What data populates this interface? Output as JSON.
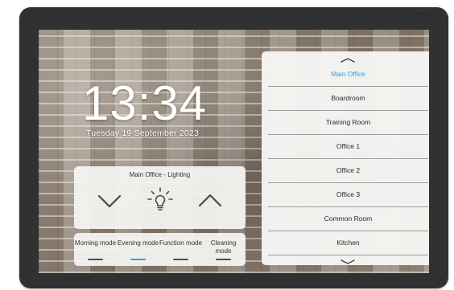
{
  "clock": {
    "time": "13:34",
    "date": "Tuesday 19 September 2023"
  },
  "lighting": {
    "title": "Main Office - Lighting",
    "controls": [
      {
        "name": "decrease-lighting-button",
        "icon": "chevron-down-icon"
      },
      {
        "name": "lighting-toggle-button",
        "icon": "lightbulb-icon"
      },
      {
        "name": "increase-lighting-button",
        "icon": "chevron-up-icon"
      }
    ]
  },
  "modes": [
    {
      "label": "Morning mode",
      "active": false
    },
    {
      "label": "Evening mode",
      "active": true
    },
    {
      "label": "Function mode",
      "active": false
    },
    {
      "label": "Cleaning mode",
      "active": false
    }
  ],
  "rooms": {
    "scroll_up_icon": "chevron-up-icon",
    "scroll_down_icon": "chevron-down-icon",
    "items": [
      {
        "label": "Main Office",
        "active": true
      },
      {
        "label": "Boardroom",
        "active": false
      },
      {
        "label": "Training Room",
        "active": false
      },
      {
        "label": "Office 1",
        "active": false
      },
      {
        "label": "Office 2",
        "active": false
      },
      {
        "label": "Office 3",
        "active": false
      },
      {
        "label": "Common Room",
        "active": false
      },
      {
        "label": "Kitchen",
        "active": false
      }
    ]
  },
  "colors": {
    "accent": "#2aa3df",
    "bezel": "#2f3133",
    "panel": "#f6f5f3",
    "text": "#333333"
  }
}
